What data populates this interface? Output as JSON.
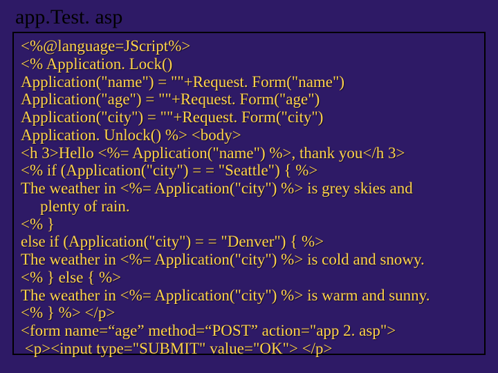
{
  "title": "app.Test. asp",
  "code": {
    "l1": "<%@language=JScript%>",
    "l2": "<% Application. Lock()",
    "l3": "Application(\"name\") = \"\"+Request. Form(\"name\")",
    "l4": "Application(\"age\") = \"\"+Request. Form(\"age\")",
    "l5": "Application(\"city\") = \"\"+Request. Form(\"city\")",
    "l6": "Application. Unlock() %> <body>",
    "l7": "<h 3>Hello <%= Application(\"name\") %>, thank you</h 3>",
    "l8": "<% if (Application(\"city\") = = \"Seattle\") { %>",
    "l9a": "The weather in <%= Application(\"city\") %> is grey skies and",
    "l9b": "plenty of rain.",
    "l10": "<% }",
    "l11": "else if (Application(\"city\") = = \"Denver\") { %>",
    "l12": "The weather in <%= Application(\"city\") %> is cold and snowy.",
    "l13": "<% } else { %>",
    "l14": "The weather in <%= Application(\"city\") %> is warm and sunny.",
    "l15": "<% } %> </p>",
    "l16": "<form name=“age” method=“POST” action=\"app 2. asp\">",
    "l17": " <p><input type=\"SUBMIT\" value=\"OK\"> </p>"
  }
}
